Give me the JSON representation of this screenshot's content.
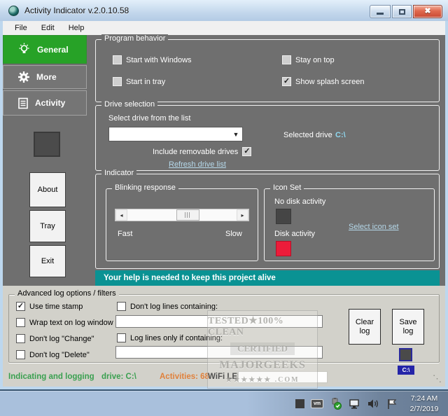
{
  "window": {
    "title": "Activity Indicator v.2.0.10.58"
  },
  "titlebar": {
    "close_glyph": "✖"
  },
  "menu": {
    "items": [
      {
        "label": "File"
      },
      {
        "label": "Edit"
      },
      {
        "label": "Help"
      }
    ]
  },
  "sidebar": {
    "tabs": [
      {
        "label": "General"
      },
      {
        "label": "More"
      },
      {
        "label": "Activity"
      }
    ],
    "buttons": [
      {
        "label": "About"
      },
      {
        "label": "Tray"
      },
      {
        "label": "Exit"
      }
    ]
  },
  "program_behavior": {
    "title": "Program behavior",
    "checkboxes": [
      {
        "label": "Start with Windows",
        "glyph": ""
      },
      {
        "label": "Start in tray",
        "glyph": ""
      },
      {
        "label": "Stay on top",
        "glyph": ""
      },
      {
        "label": "Show splash screen",
        "glyph": "✓"
      }
    ]
  },
  "drive_selection": {
    "title": "Drive selection",
    "select_label": "Select drive from the list",
    "combo_value": "",
    "combo_caret": "▼",
    "include_removable_label": "Include removable drives",
    "include_removable_glyph": "✓",
    "refresh_link": "Refresh drive list",
    "selected_drive_label": "Selected drive",
    "selected_drive_value": "C:\\"
  },
  "indicator": {
    "title": "Indicator",
    "blinking": {
      "title": "Blinking response",
      "fast": "Fast",
      "slow": "Slow",
      "left_arrow": "◂",
      "right_arrow": "▸"
    },
    "icon_set": {
      "title": "Icon Set",
      "no_activity": "No disk activity",
      "activity": "Disk activity",
      "link": "Select icon set"
    }
  },
  "banner": {
    "text": "Your help is needed to keep this project alive"
  },
  "advanced": {
    "title": "Advanced log options / filters",
    "checkboxes": [
      {
        "label": "Use time stamp",
        "glyph": "✓"
      },
      {
        "label": "Wrap text on log window",
        "glyph": ""
      },
      {
        "label": "Don't log \"Change\"",
        "glyph": ""
      },
      {
        "label": "Don't log \"Delete\"",
        "glyph": ""
      }
    ],
    "filter1_label": "Don't log lines containing:",
    "filter1_glyph": "",
    "filter1_value": "",
    "filter2_label": "Log lines only if containing:",
    "filter2_glyph": "",
    "filter2_value": "",
    "clear_button": "Clear log",
    "save_button": "Save log",
    "badge": "C:\\"
  },
  "watermark": {
    "line1": "TESTED★100% CLEAN",
    "line2": "CERTIFIED",
    "line3": "MAJORGEEKS",
    "line4": "★★★★★★ .COM"
  },
  "status": {
    "part1": "Indicating and logging",
    "part2": "drive: C:\\",
    "part3": "Activities: 68",
    "part4": "WiFi LED:",
    "grip_glyph": "⋱"
  },
  "taskbar": {
    "vm_label": "vm",
    "time": "7:24 AM",
    "date": "2/7/2019"
  },
  "colors": {
    "accent_green": "#27a227",
    "teal_banner": "#0a9293",
    "activity_red": "#ec1c3a",
    "dark_panel": "#6f6f6f",
    "light_panel": "#d2d1ca",
    "status_green": "#3aa050",
    "status_orange": "#e0813c",
    "selected_drive_cyan": "#8fd8f0"
  }
}
